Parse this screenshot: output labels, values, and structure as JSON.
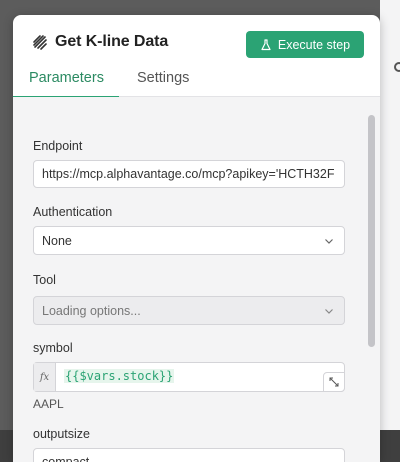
{
  "modal": {
    "title": "Get K-line Data",
    "execute_label": "Execute step"
  },
  "tabs": [
    {
      "label": "Parameters",
      "active": true
    },
    {
      "label": "Settings",
      "active": false
    }
  ],
  "fields": {
    "endpoint": {
      "label": "Endpoint",
      "value": "https://mcp.alphavantage.co/mcp?apikey='HCTH32F"
    },
    "authentication": {
      "label": "Authentication",
      "value": "None"
    },
    "tool": {
      "label": "Tool",
      "value": "Loading options..."
    },
    "symbol": {
      "label": "symbol",
      "fx": "fx",
      "expression": "{{$vars.stock}}",
      "result": "AAPL"
    },
    "outputsize": {
      "label": "outputsize",
      "value": "compact"
    }
  },
  "colors": {
    "accent": "#2ba374",
    "panel_bg": "#f4f4f5",
    "overlay": "#5c5c5c"
  },
  "icons": {
    "node": "node-lines-icon",
    "execute": "flask-icon",
    "chevron": "chevron-down-icon",
    "expand": "expand-icon"
  }
}
